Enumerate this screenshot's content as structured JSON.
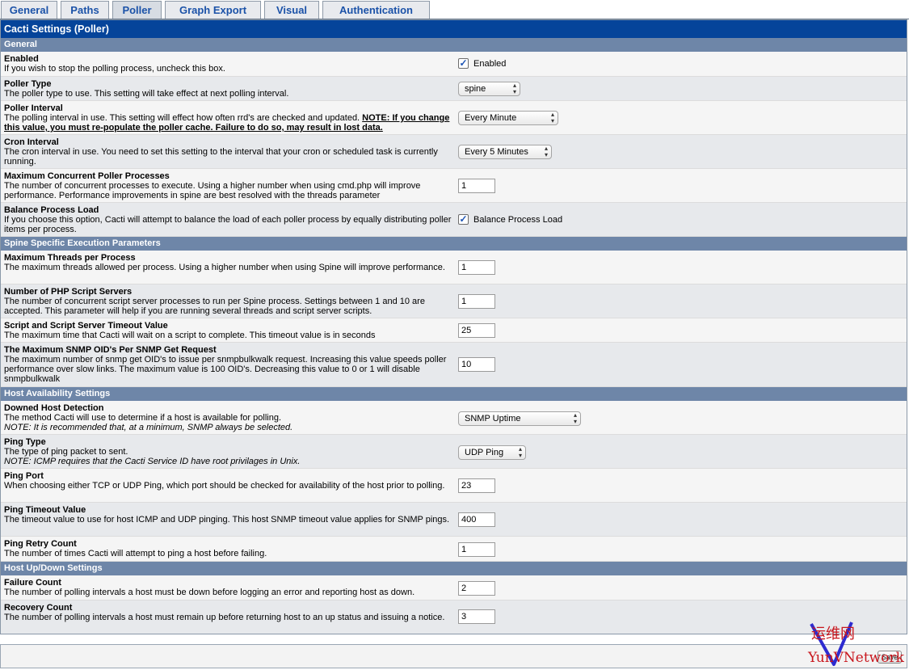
{
  "tabs": [
    "General",
    "Paths",
    "Poller",
    "Graph Export",
    "Visual",
    "Authentication"
  ],
  "title": "Cacti Settings (Poller)",
  "sections": {
    "general": "General",
    "spine": "Spine Specific Execution Parameters",
    "host_avail": "Host Availability Settings",
    "updown": "Host Up/Down Settings"
  },
  "settings": {
    "enabled": {
      "name": "Enabled",
      "desc": "If you wish to stop the polling process, uncheck this box.",
      "label": "Enabled",
      "checked": true
    },
    "poller_type": {
      "name": "Poller Type",
      "desc": "The poller type to use. This setting will take effect at next polling interval.",
      "value": "spine"
    },
    "poller_interval": {
      "name": "Poller Interval",
      "desc": "The polling interval in use. This setting will effect how often rrd's are checked and updated. ",
      "warn": "NOTE: If you change this value, you must re-populate the poller cache. Failure to do so, may result in lost data.",
      "value": "Every Minute"
    },
    "cron_interval": {
      "name": "Cron Interval",
      "desc": "The cron interval in use. You need to set this setting to the interval that your cron or scheduled task is currently running.",
      "value": "Every 5 Minutes"
    },
    "max_processes": {
      "name": "Maximum Concurrent Poller Processes",
      "desc": "The number of concurrent processes to execute. Using a higher number when using cmd.php will improve performance. Performance improvements in spine are best resolved with the threads parameter",
      "value": "1"
    },
    "balance": {
      "name": "Balance Process Load",
      "desc": "If you choose this option, Cacti will attempt to balance the load of each poller process by equally distributing poller items per process.",
      "label": "Balance Process Load",
      "checked": true
    },
    "max_threads": {
      "name": "Maximum Threads per Process",
      "desc": "The maximum threads allowed per process. Using a higher number when using Spine will improve performance.",
      "value": "1"
    },
    "php_servers": {
      "name": "Number of PHP Script Servers",
      "desc": "The number of concurrent script server processes to run per Spine process. Settings between 1 and 10 are accepted. This parameter will help if you are running several threads and script server scripts.",
      "value": "1"
    },
    "script_timeout": {
      "name": "Script and Script Server Timeout Value",
      "desc": "The maximum time that Cacti will wait on a script to complete. This timeout value is in seconds",
      "value": "25"
    },
    "max_oids": {
      "name": "The Maximum SNMP OID's Per SNMP Get Request",
      "desc": "The maximum number of snmp get OID's to issue per snmpbulkwalk request. Increasing this value speeds poller performance over slow links. The maximum value is 100 OID's. Decreasing this value to 0 or 1 will disable snmpbulkwalk",
      "value": "10"
    },
    "downed_detect": {
      "name": "Downed Host Detection",
      "desc": "The method Cacti will use to determine if a host is available for polling.",
      "note": "NOTE: It is recommended that, at a minimum, SNMP always be selected.",
      "value": "SNMP Uptime"
    },
    "ping_type": {
      "name": "Ping Type",
      "desc": "The type of ping packet to sent.",
      "note": "NOTE: ICMP requires that the Cacti Service ID have root privilages in Unix.",
      "value": "UDP Ping"
    },
    "ping_port": {
      "name": "Ping Port",
      "desc": "When choosing either TCP or UDP Ping, which port should be checked for availability of the host prior to polling.",
      "value": "23"
    },
    "ping_timeout": {
      "name": "Ping Timeout Value",
      "desc": "The timeout value to use for host ICMP and UDP pinging. This host SNMP timeout value applies for SNMP pings.",
      "value": "400"
    },
    "ping_retry": {
      "name": "Ping Retry Count",
      "desc": "The number of times Cacti will attempt to ping a host before failing.",
      "value": "1"
    },
    "failure_count": {
      "name": "Failure Count",
      "desc": "The number of polling intervals a host must be down before logging an error and reporting host as down.",
      "value": "2"
    },
    "recovery_count": {
      "name": "Recovery Count",
      "desc": "The number of polling intervals a host must remain up before returning host to an up status and issuing a notice.",
      "value": "3"
    }
  },
  "save_button": "Save",
  "watermark": {
    "cn": "运维网",
    "en": "YunVNetwork"
  },
  "colors": {
    "title_bar": "#05449a",
    "section_bar": "#6e86a8",
    "tab_text": "#1b52a8",
    "watermark": "#c8161d"
  }
}
